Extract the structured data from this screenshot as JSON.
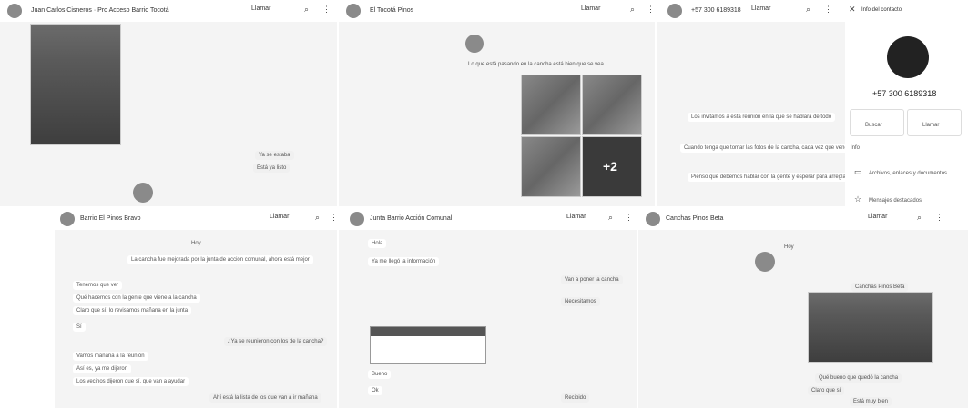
{
  "panels": {
    "p1": {
      "name": "Juan Carlos Cisneros · Pro Acceso Barrio Tocotá",
      "call": "Llamar"
    },
    "p2": {
      "name": "El Tocotá Pinos",
      "call": "Llamar"
    },
    "p3": {
      "name": "+57 300 6189318",
      "call": "Llamar",
      "header_phone": "+57 300 6189318"
    },
    "p4": {
      "name": "Barrio El Pinos Bravo",
      "call": "Llamar"
    },
    "p5": {
      "name": "Junta Barrio Acción Comunal",
      "call": "Llamar"
    },
    "p6": {
      "name": "Canchas Pinos Beta",
      "call": "Llamar"
    }
  },
  "contact_info": {
    "title": "Info del contacto",
    "phone": "+57 300 6189318",
    "action1": "Buscar",
    "action2": "Llamar",
    "about_label": "Info",
    "item1": "Archivos, enlaces y documentos",
    "item2": "Mensajes destacados"
  },
  "p1_msgs": {
    "m1": "Ya se estaba",
    "m2": "Está ya listo"
  },
  "p2_msgs": {
    "m1": "Lo que está pasando en la cancha está bien que se vea",
    "more": "+2"
  },
  "p3_msgs": {
    "m1": "Los invitamos a esta reunión en la que se hablará de todo",
    "m2": "Cuando tenga que tomar las fotos de la cancha, cada vez que venga",
    "m3": "Pienso que debemos hablar con la gente y esperar para arreglar"
  },
  "p4_msgs": {
    "m1": "Hoy",
    "m2": "La cancha fue mejorada por la junta de acción comunal, ahora está mejor",
    "m3": "Tenemos que ver",
    "m4": "Qué hacemos con la gente que viene a la cancha",
    "m5": "Claro que sí, lo revisamos mañana en la junta",
    "m6": "Sí",
    "m7": "¿Ya se reunieron con los de la cancha?",
    "m8": "Vamos mañana a la reunión",
    "m9": "Así es, ya me dijeron",
    "m10": "Los vecinos dijeron que sí, que van a ayudar",
    "m11": "Ahí está la lista de los que van a ir mañana"
  },
  "p5_msgs": {
    "m1": "Hola",
    "m2": "Ya me llegó la información",
    "m3": "Van a poner la cancha",
    "m4": "Necesitamos",
    "m5": "Bueno",
    "m6": "Ok",
    "m7": "Recibido"
  },
  "p6_msgs": {
    "m1": "Hoy",
    "m2": "Canchas Pinos Beta",
    "m3": "Qué bueno que quedó la cancha",
    "m4": "Claro que sí",
    "m5": "Está muy bien"
  }
}
